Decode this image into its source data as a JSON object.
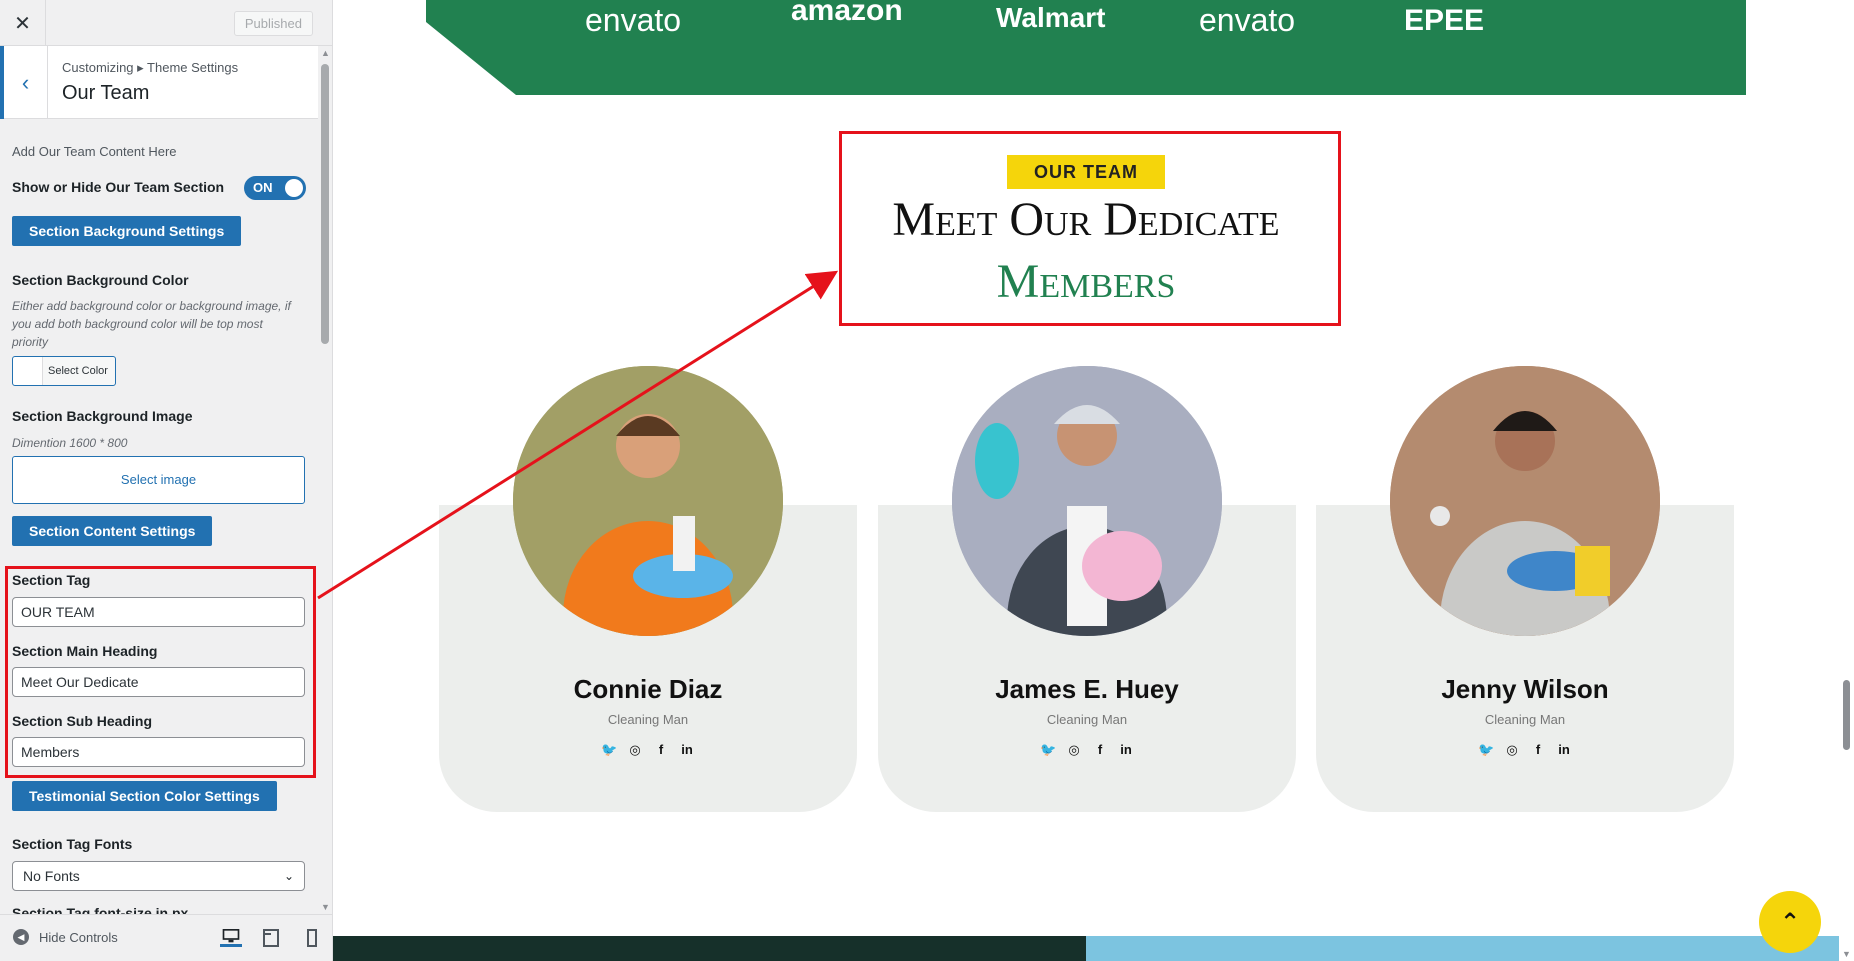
{
  "customizer": {
    "published_label": "Published",
    "breadcrumb": "Customizing ▸ Theme Settings",
    "panel_title": "Our Team",
    "intro": "Add Our Team Content Here",
    "show_hide_label": "Show or Hide Our Team Section",
    "toggle_state": "ON",
    "bg_settings_btn": "Section Background Settings",
    "bg_color_label": "Section Background Color",
    "bg_color_desc": "Either add background color or background image, if you add both background color will be top most priority",
    "select_color_btn": "Select Color",
    "bg_image_label": "Section Background Image",
    "bg_image_desc": "Dimention 1600 * 800",
    "select_image_btn": "Select image",
    "content_settings_btn": "Section Content Settings",
    "tag_label": "Section Tag",
    "tag_value": "OUR TEAM",
    "main_heading_label": "Section Main Heading",
    "main_heading_value": "Meet Our Dedicate",
    "sub_heading_label": "Section Sub Heading",
    "sub_heading_value": "Members",
    "color_settings_btn": "Testimonial Section Color Settings",
    "tag_fonts_label": "Section Tag Fonts",
    "tag_fonts_value": "No Fonts",
    "tag_fontsize_label": "Section Tag font-size in px",
    "hide_controls": "Hide Controls"
  },
  "preview": {
    "brands": [
      "envato",
      "amazon",
      "Walmart",
      "envato",
      "EPEE"
    ],
    "team_tag": "OUR TEAM",
    "team_heading": "Meet Our Dedicate",
    "team_sub": "Members",
    "members": [
      {
        "name": "Connie Diaz",
        "role": "Cleaning Man"
      },
      {
        "name": "James E. Huey",
        "role": "Cleaning Man"
      },
      {
        "name": "Jenny Wilson",
        "role": "Cleaning Man"
      }
    ]
  },
  "colors": {
    "accent": "#2271b1",
    "brand_green": "#218150",
    "tag_yellow": "#f5d50b",
    "annotation_red": "#e5121b"
  }
}
